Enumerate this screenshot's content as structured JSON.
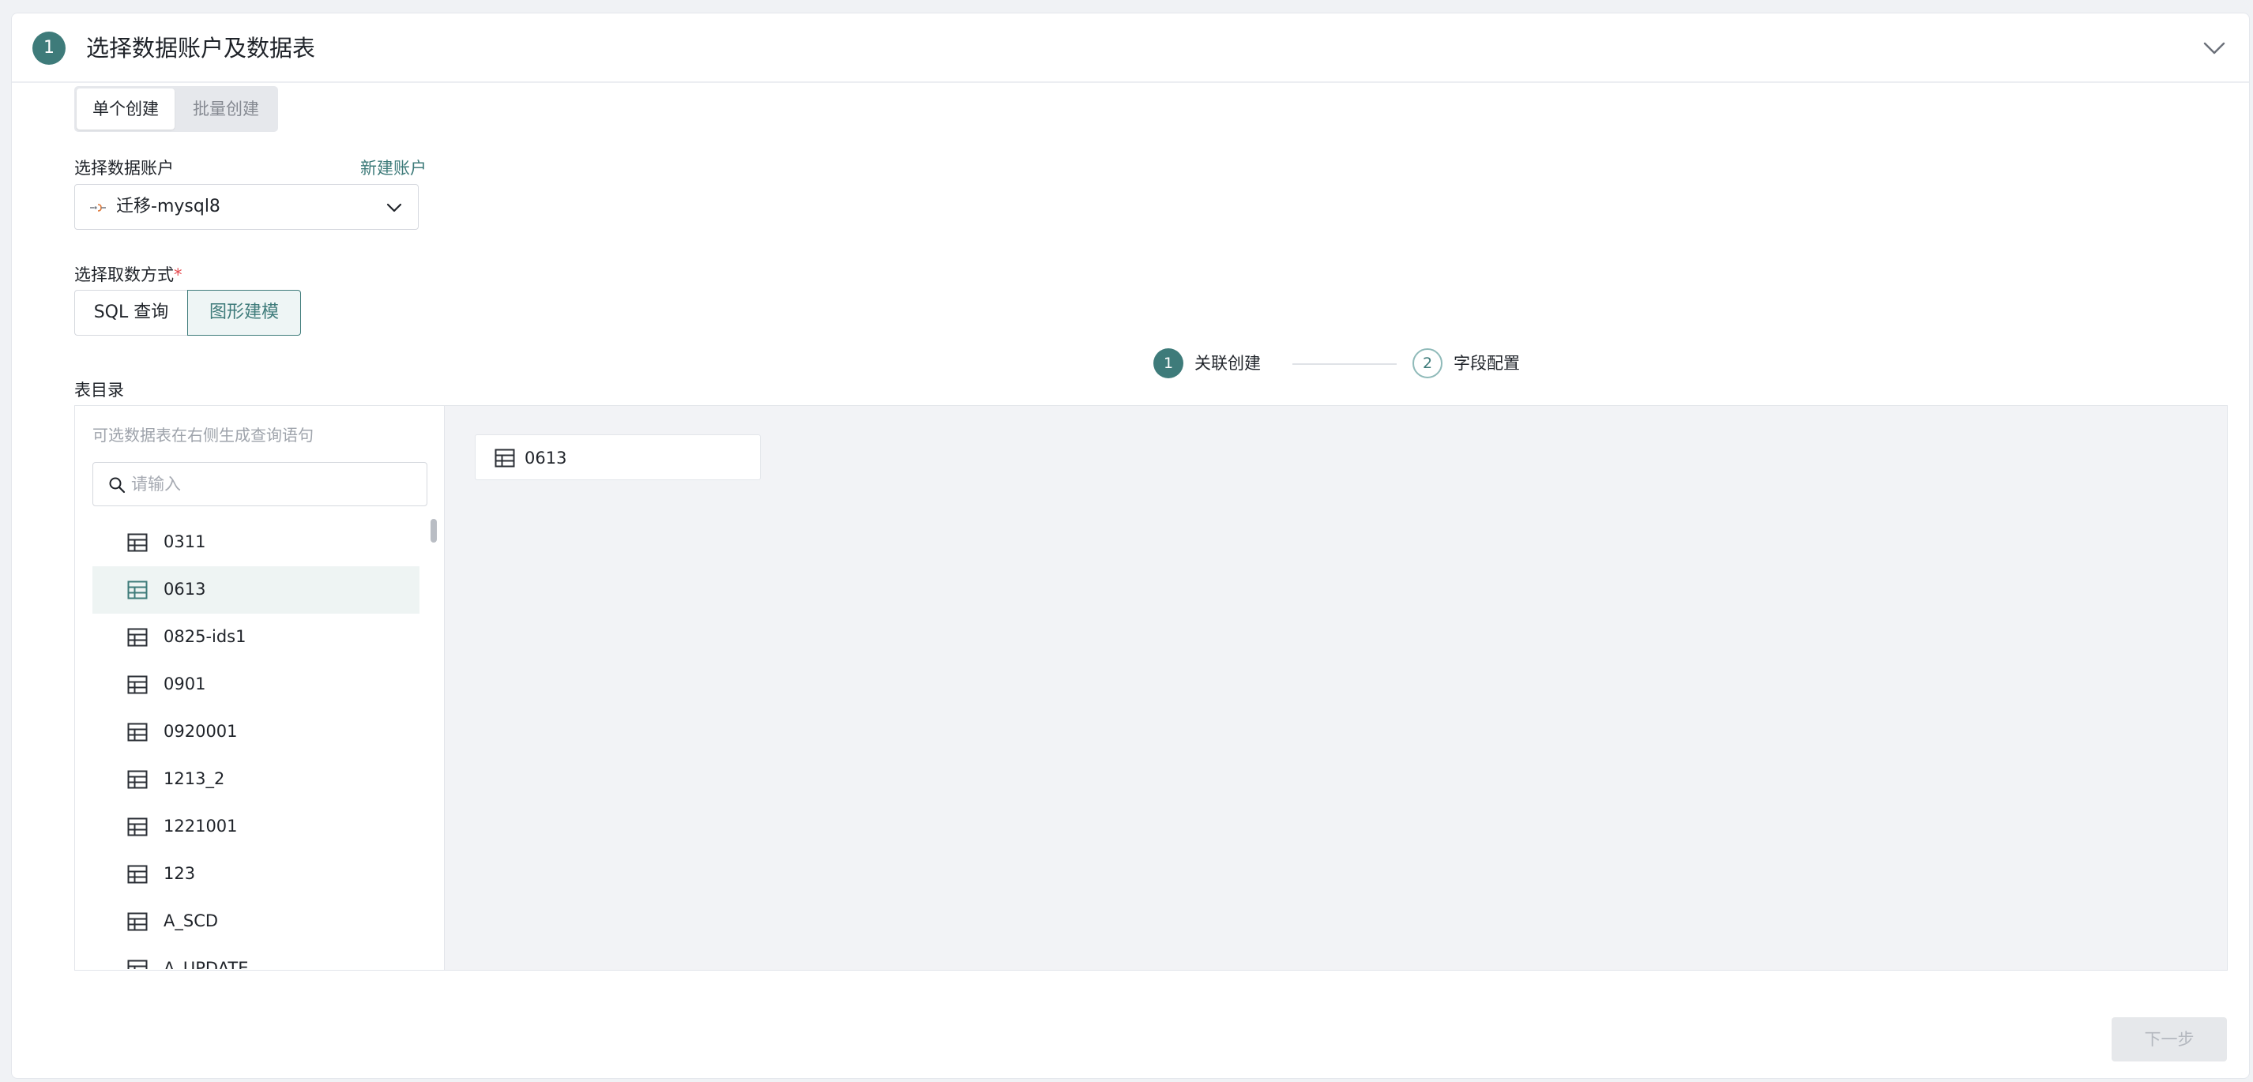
{
  "header": {
    "step_number": "1",
    "title": "选择数据账户及数据表"
  },
  "create_mode": {
    "single": "单个创建",
    "batch": "批量创建",
    "selected": "单个创建"
  },
  "account": {
    "label": "选择数据账户",
    "new_account_link": "新建账户",
    "selected_value": "迁移-mysql8",
    "icon": "database-plug-icon"
  },
  "method": {
    "label": "选择取数方式",
    "required_mark": "*",
    "sql_label": "SQL 查询",
    "graph_label": "图形建模",
    "selected": "图形建模"
  },
  "table_dir": {
    "label": "表目录",
    "hint": "可选数据表在右侧生成查询语句",
    "search_placeholder": "请输入",
    "items": [
      {
        "label": "0311",
        "selected": false
      },
      {
        "label": "0613",
        "selected": true
      },
      {
        "label": "0825-ids1",
        "selected": false
      },
      {
        "label": "0901",
        "selected": false
      },
      {
        "label": "0920001",
        "selected": false
      },
      {
        "label": "1213_2",
        "selected": false
      },
      {
        "label": "1221001",
        "selected": false
      },
      {
        "label": "123",
        "selected": false
      },
      {
        "label": "A_SCD",
        "selected": false
      },
      {
        "label": "A_UPDATE",
        "selected": false
      }
    ]
  },
  "steps": [
    {
      "number": "1",
      "label": "关联创建",
      "active": true
    },
    {
      "number": "2",
      "label": "字段配置",
      "active": false
    }
  ],
  "canvas": {
    "nodes": [
      {
        "label": "0613"
      }
    ]
  },
  "footer": {
    "next_label": "下一步"
  },
  "colors": {
    "accent": "#3e7b7a",
    "required": "#e5484d"
  }
}
